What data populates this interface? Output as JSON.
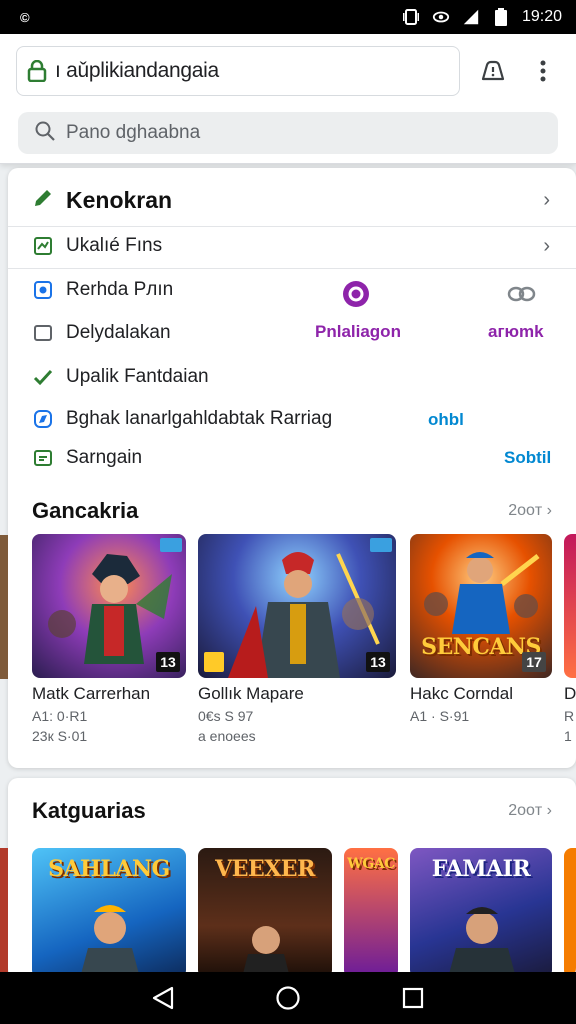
{
  "status_bar": {
    "left_label": "©",
    "time": "19:20"
  },
  "header": {
    "url": "ı aǔplikiandangaia",
    "search_placeholder": "Pano dghaabna"
  },
  "menu": {
    "title": "Kenokran",
    "items": [
      {
        "label": "Ukalıé Fıns",
        "icon": "chart-icon",
        "color": "#2e7d32"
      },
      {
        "label": "Rerhda Pлın",
        "icon": "shield-icon",
        "color": "#1a73e8"
      },
      {
        "label": "Delydalakan",
        "icon": "square-icon",
        "color": "#5f6368"
      },
      {
        "label": "Upalik Fantdaian",
        "icon": "check-icon",
        "color": "#2e7d32"
      },
      {
        "label": "Bghak lanarlgahldabtak Rarriag",
        "icon": "compass-icon",
        "color": "#1a73e8"
      },
      {
        "label": "Sarngain",
        "icon": "ticket-icon",
        "color": "#2e7d32"
      }
    ],
    "side_labels": {
      "purple_text": "Pnlaliagon",
      "purple_text_2": "aгюmk",
      "blue_text": "ohbl",
      "blue_text_2": "Sobtil"
    }
  },
  "games_section": {
    "title": "Gancakria",
    "see_all": "2ooт",
    "games": [
      {
        "title": "Matk Carrerhan",
        "meta1": "A1: 0·R1",
        "meta2": "23к S·01",
        "age": "13"
      },
      {
        "title": "Gollık Mapare",
        "meta1": "0€s S 97",
        "meta2": "a enoees",
        "age": "13"
      },
      {
        "title": "Hakc Corndal",
        "meta1": "A1 · S·91",
        "meta2": "",
        "age": "17",
        "logo": "SENCANS"
      }
    ],
    "peek": {
      "title": "D",
      "meta1": "R",
      "meta2": "1"
    }
  },
  "categories_section": {
    "title": "Katguarias",
    "see_all": "2ooт",
    "tiles": [
      {
        "logo": "SAHLANG"
      },
      {
        "logo": "VEEXER"
      },
      {
        "logo": "WGAC"
      },
      {
        "logo": "FAMAIR"
      }
    ]
  },
  "colors": {
    "accent_green": "#2e7d32",
    "accent_blue": "#1a73e8",
    "accent_purple": "#8e24aa",
    "teal": "#0288d1"
  }
}
